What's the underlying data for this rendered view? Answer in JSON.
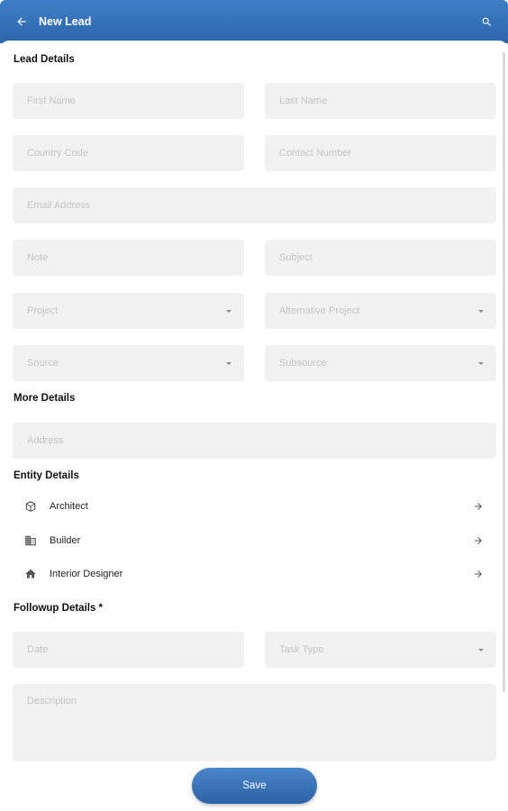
{
  "app_bar": {
    "title": "New Lead",
    "back_icon": "arrow-left-icon",
    "search_icon": "search-icon",
    "color": "#2d65aa"
  },
  "lead_details": {
    "title": "Lead Details",
    "first_name": "First Name",
    "last_name": "Last Name",
    "country_code": "Country Code",
    "contact_number": "Contact Number",
    "email": "Email Address",
    "note": "Note",
    "subject": "Subject",
    "project": "Project",
    "alternative_project": "Alternative Project",
    "source": "Source",
    "subsource": "Subsource"
  },
  "more_details": {
    "title": "More Details",
    "address": "Address"
  },
  "entity_details": {
    "title": "Entity Details",
    "items": [
      {
        "label": "Architect",
        "icon": "cube-icon"
      },
      {
        "label": "Builder",
        "icon": "building-icon"
      },
      {
        "label": "Interior Designer",
        "icon": "home-icon"
      }
    ]
  },
  "followup_details": {
    "title": "Followup Details *",
    "date": "Date",
    "task_type": "Task Type",
    "description": "Description"
  },
  "save_label": "Save"
}
